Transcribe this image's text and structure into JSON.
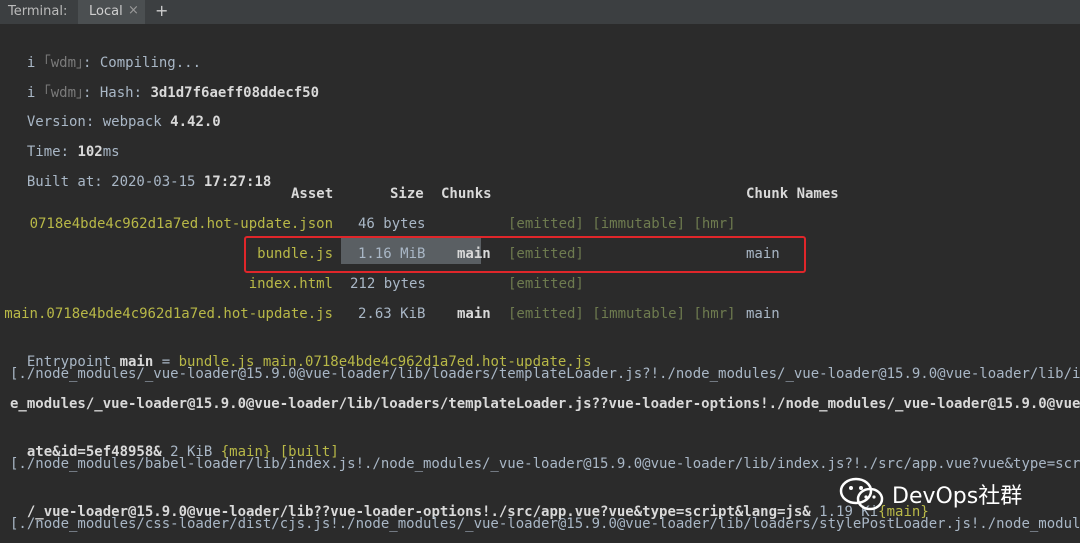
{
  "tabbar": {
    "title": "Terminal:",
    "tab_label": "Local",
    "close_symbol": "×",
    "add_symbol": "+"
  },
  "lines": {
    "l1": {
      "prefix": "i ",
      "tag": "｢wdm｣",
      "text": ": Compiling..."
    },
    "l2": {
      "prefix": "i ",
      "tag": "｢wdm｣",
      "text": ": Hash: ",
      "value": "3d1d7f6aeff08ddecf50"
    },
    "l3": {
      "text": "Version: webpack ",
      "value": "4.42.0"
    },
    "l4": {
      "text": "Time: ",
      "value": "102",
      "unit": "ms"
    },
    "l5": {
      "text": "Built at: 2020-03-15 ",
      "value": "17:27:18"
    }
  },
  "table": {
    "headers": {
      "asset": "Asset",
      "size": "Size",
      "chunks": "Chunks",
      "chunk_names": "Chunk Names"
    },
    "rows": [
      {
        "asset": "0718e4bde4c962d1a7ed.hot-update.json",
        "size": "46 bytes",
        "chunks": "",
        "flags": "[emitted] [immutable] [hmr]",
        "names": ""
      },
      {
        "asset": "bundle.js",
        "size": "1.16 MiB",
        "chunks": "main",
        "flags": "[emitted]",
        "names": "main"
      },
      {
        "asset": "index.html",
        "size": "212 bytes",
        "chunks": "",
        "flags": "[emitted]",
        "names": ""
      },
      {
        "asset": "main.0718e4bde4c962d1a7ed.hot-update.js",
        "size": "2.63 KiB",
        "chunks": "main",
        "flags": "[emitted] [immutable] [hmr]",
        "names": "main"
      }
    ]
  },
  "entrypoint": {
    "label": "Entrypoint ",
    "name": "main",
    "eq": " = ",
    "files": "bundle.js main.0718e4bde4c962d1a7ed.hot-update.js"
  },
  "modules": {
    "m1": "[./node_modules/_vue-loader@15.9.0@vue-loader/lib/loaders/templateLoader.js?!./node_modules/_vue-loader@15.9.0@vue-loader/lib/inde",
    "m2": "e_modules/_vue-loader@15.9.0@vue-loader/lib/loaders/templateLoader.js??vue-loader-options!./node_modules/_vue-loader@15.9.0@vue-lo",
    "m3a": "ate&id=5ef48958&",
    "m3b": " 2 KiB ",
    "m3c": "{main}",
    "m3d": " [built]",
    "m4": "[./node_modules/babel-loader/lib/index.js!./node_modules/_vue-loader@15.9.0@vue-loader/lib/index.js?!./src/app.vue?vue&type=script",
    "m5a": "/_vue-loader@15.9.0@vue-loader/lib??vue-loader-options!./src/app.vue?vue&type=script&lang=js&",
    "m5b": " 1.19 Ki",
    "m5c": "{main}",
    "m6": "[./node_modules/css-loader/dist/cjs.js!./node_modules/_vue-loader@15.9.0@vue-loader/lib/loaders/stylePostLoader.js!./node_modules/_"
  },
  "watermark": {
    "text": "DevOps社群",
    "icon": "wechat-icon"
  },
  "colors": {
    "background": "#2b2b2b",
    "tabbar": "#3c3f41",
    "asset_gold": "#b8b847",
    "emitted_dim": "#6e7b4f",
    "highlight_border": "#e0262a"
  }
}
